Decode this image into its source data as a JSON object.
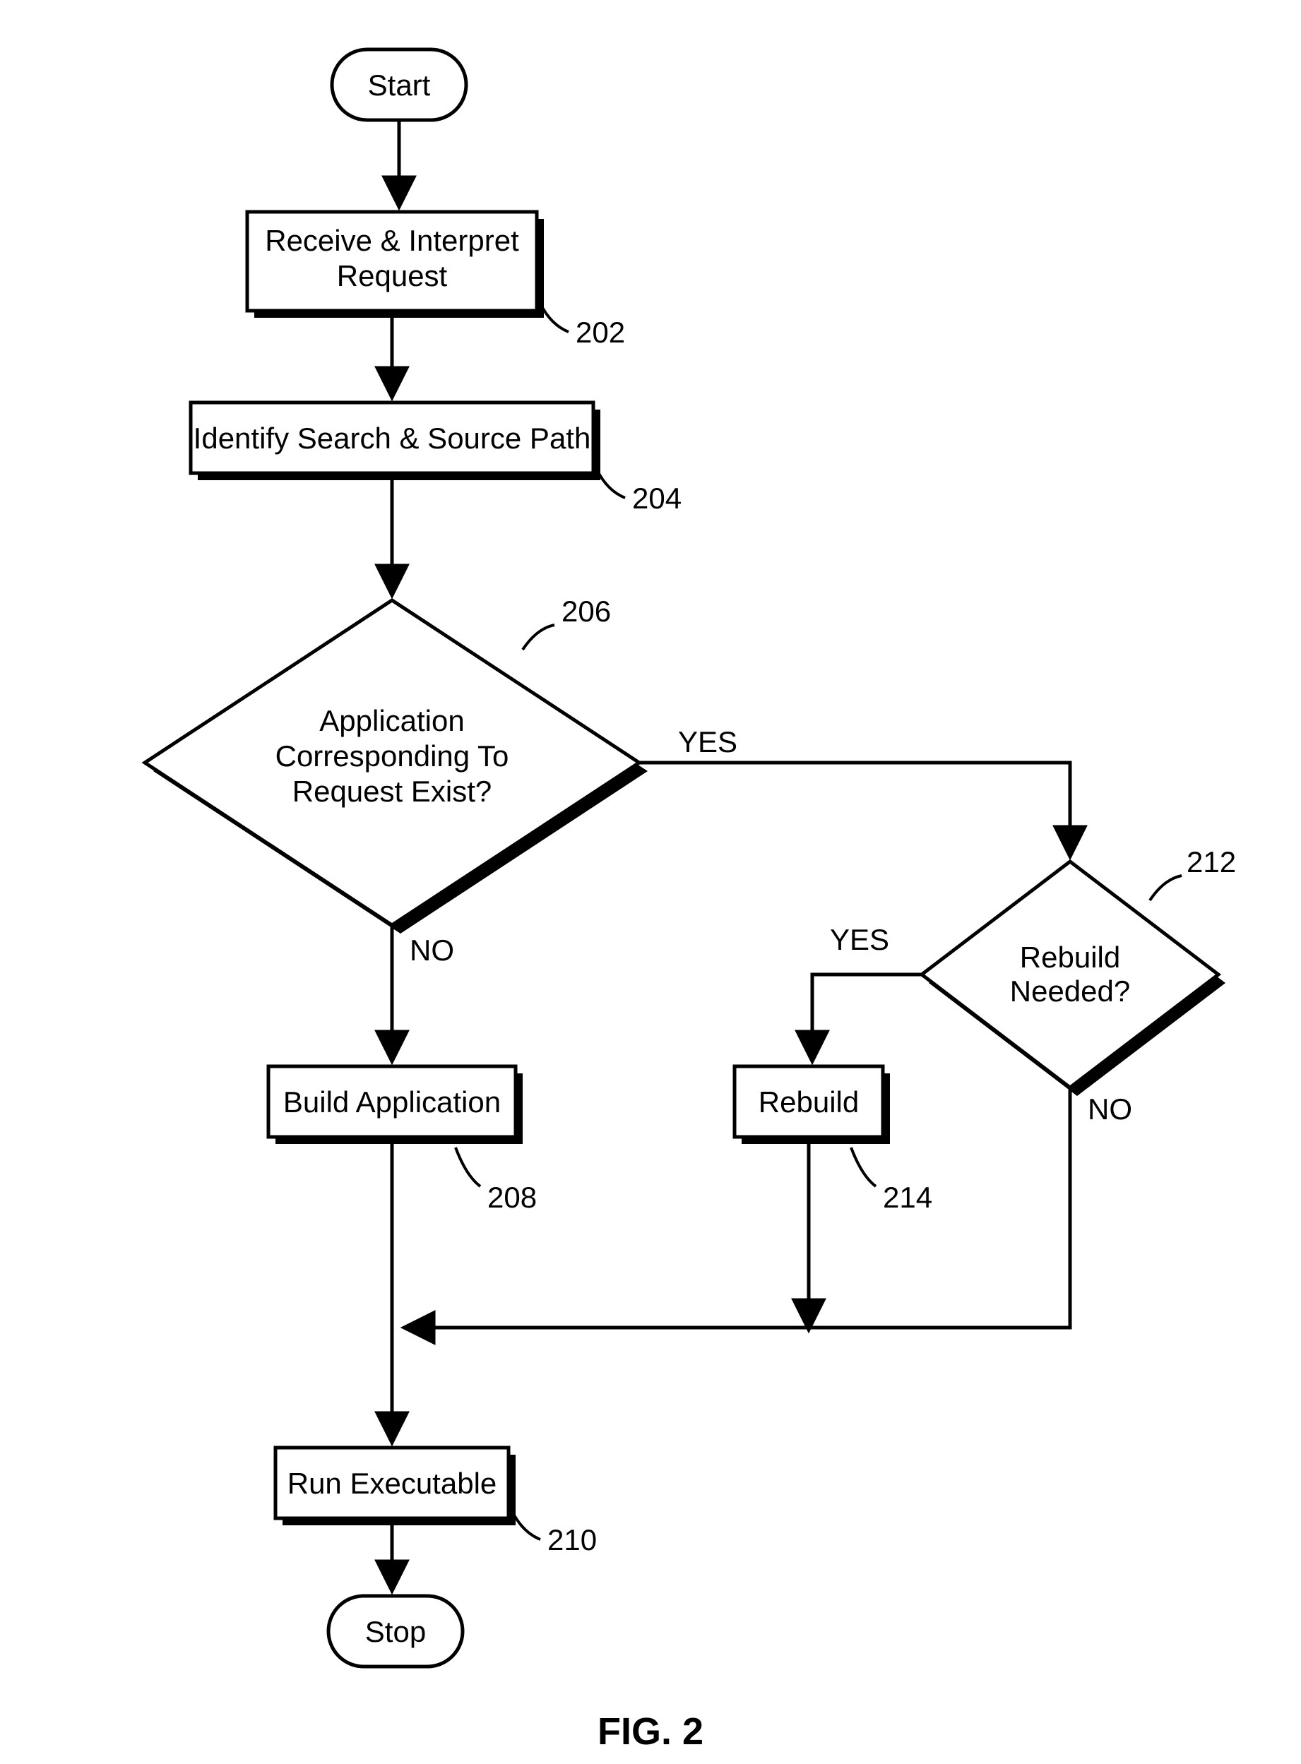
{
  "nodes": {
    "start": "Start",
    "stop": "Stop",
    "n202": {
      "l1": "Receive & Interpret",
      "l2": "Request",
      "ref": "202"
    },
    "n204": {
      "l1": "Identify Search & Source Path",
      "ref": "204"
    },
    "n206": {
      "l1": "Application",
      "l2": "Corresponding To",
      "l3": "Request Exist?",
      "ref": "206"
    },
    "n208": {
      "l1": "Build Application",
      "ref": "208"
    },
    "n210": {
      "l1": "Run Executable",
      "ref": "210"
    },
    "n212": {
      "l1": "Rebuild",
      "l2": "Needed?",
      "ref": "212"
    },
    "n214": {
      "l1": "Rebuild",
      "ref": "214"
    }
  },
  "edges": {
    "yes": "YES",
    "no": "NO"
  },
  "caption": "FIG. 2"
}
